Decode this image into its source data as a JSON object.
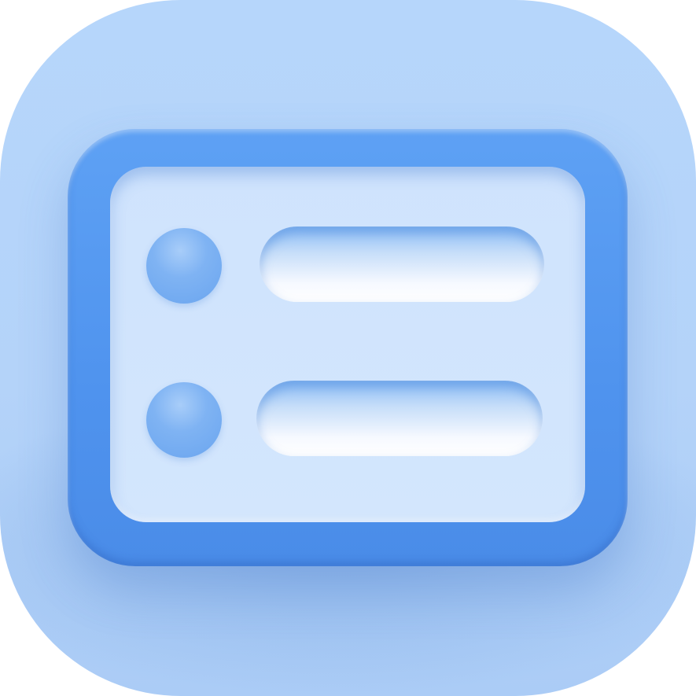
{
  "icon": {
    "name": "list-icon",
    "colors": {
      "tile": "#b6d6fb",
      "frame": "#5ea1f4",
      "panel": "#cfe3fd",
      "dot": "#7fb3f3",
      "bar_highlight": "#ffffff"
    },
    "rows": [
      {
        "bullet": "bullet-dot",
        "line": "line-bar"
      },
      {
        "bullet": "bullet-dot",
        "line": "line-bar"
      }
    ]
  }
}
